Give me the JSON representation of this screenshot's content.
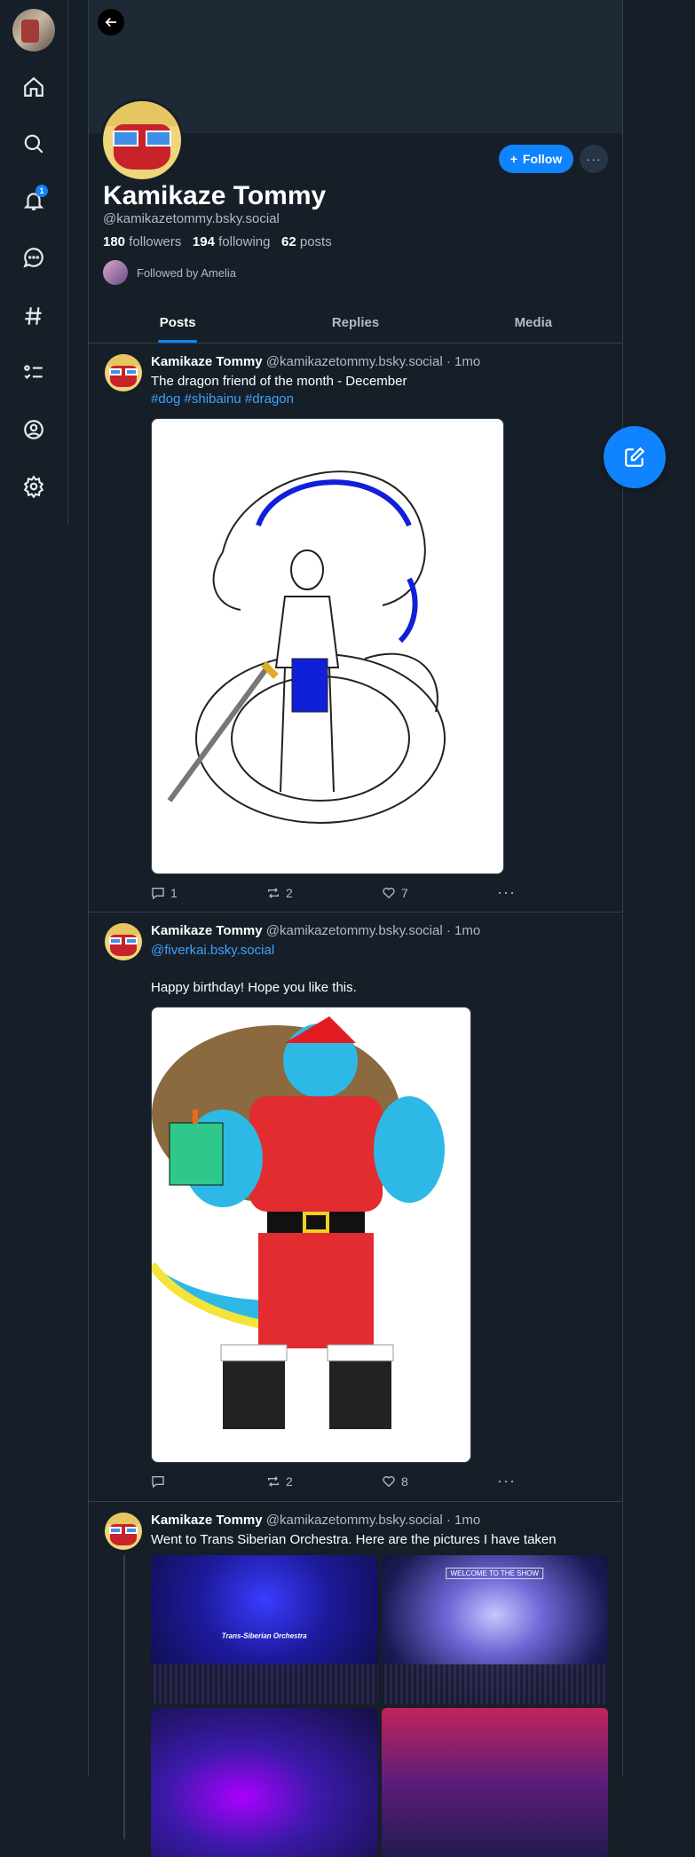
{
  "nav": {
    "notifications_badge": "1",
    "items": [
      "home-icon",
      "search-icon",
      "bell-icon",
      "chat-icon",
      "hashtag-icon",
      "list-icon",
      "profile-icon",
      "gear-icon"
    ]
  },
  "profile": {
    "display_name": "Kamikaze Tommy",
    "handle": "@kamikazetommy.bsky.social",
    "followers_count": "180",
    "followers_label": "followers",
    "following_count": "194",
    "following_label": "following",
    "posts_count": "62",
    "posts_label": "posts",
    "followed_by": "Followed by Amelia",
    "follow_label": "Follow",
    "more_label": "···"
  },
  "tabs": [
    {
      "label": "Posts",
      "active": true
    },
    {
      "label": "Replies",
      "active": false
    },
    {
      "label": "Media",
      "active": false
    }
  ],
  "posts": [
    {
      "author": "Kamikaze Tommy",
      "handle": "@kamikazetommy.bsky.social",
      "time": "· 1mo",
      "text": "The dragon friend of the month - December",
      "tags": "#dog #shibainu #dragon",
      "replies": "1",
      "reposts": "2",
      "likes": "7"
    },
    {
      "author": "Kamikaze Tommy",
      "handle": "@kamikazetommy.bsky.social",
      "time": "· 1mo",
      "mention": "@fiverkai.bsky.social",
      "text": "Happy birthday! Hope you like this.",
      "replies": "",
      "reposts": "2",
      "likes": "8"
    },
    {
      "author": "Kamikaze Tommy",
      "handle": "@kamikazetommy.bsky.social",
      "time": "· 1mo",
      "text": "Went to Trans Siberian Orchestra. Here are the pictures I have taken",
      "image1_label": "Trans-Siberian Orchestra",
      "image2_label": "WELCOME TO THE SHOW"
    }
  ],
  "colors": {
    "background": "#161e27",
    "accent": "#1083fe",
    "border": "#2e4052",
    "muted_text": "#aebbc9",
    "link": "#3da2ff"
  }
}
